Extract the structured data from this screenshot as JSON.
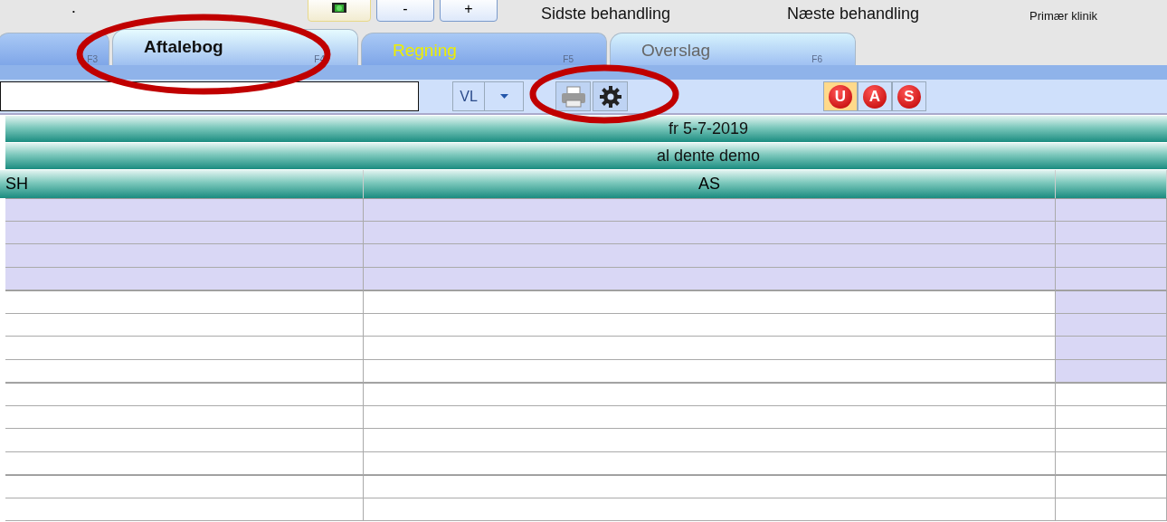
{
  "top_bar": {
    "dot": "•",
    "buttons": [
      {
        "kind": "icon"
      },
      {
        "kind": "text",
        "label": "-"
      },
      {
        "kind": "text",
        "label": "+"
      }
    ],
    "labels": [
      "Sidste behandling",
      "Næste behandling",
      "Primær klinik"
    ]
  },
  "tabs": [
    {
      "key": "F3",
      "selected": false
    },
    {
      "label": "Aftalebog",
      "key": "F4",
      "selected": true,
      "color": "#111111"
    },
    {
      "label": "Regning",
      "key": "F5",
      "selected": false,
      "color": "#eeee00"
    },
    {
      "label": "Overslag",
      "key": "F6",
      "selected": false,
      "color": "#666666"
    }
  ],
  "toolbar": {
    "select": {
      "value": "VL"
    },
    "status_buttons": [
      {
        "label": "U",
        "selected": true
      },
      {
        "label": "A",
        "selected": false
      },
      {
        "label": "S",
        "selected": false
      }
    ]
  },
  "schedule": {
    "date": "fr 5-7-2019",
    "clinic": "al dente demo",
    "columns": [
      {
        "kind": "label",
        "label": "SH"
      },
      {
        "kind": "label",
        "label": "AS"
      },
      {
        "kind": "blank"
      }
    ],
    "rows": [
      {
        "shaded": [
          true,
          true,
          true
        ]
      },
      {
        "shaded": [
          true,
          true,
          true
        ]
      },
      {
        "shaded": [
          true,
          true,
          true
        ]
      },
      {
        "shaded": [
          true,
          true,
          true
        ]
      },
      {
        "shaded": [
          false,
          false,
          true
        ]
      },
      {
        "shaded": [
          false,
          false,
          true
        ]
      },
      {
        "shaded": [
          false,
          false,
          true
        ]
      },
      {
        "shaded": [
          false,
          false,
          true
        ]
      },
      {
        "shaded": [
          false,
          false,
          false
        ]
      },
      {
        "shaded": [
          false,
          false,
          false
        ]
      },
      {
        "shaded": [
          false,
          false,
          false
        ]
      },
      {
        "shaded": [
          false,
          false,
          false
        ]
      },
      {
        "shaded": [
          false,
          false,
          false
        ]
      },
      {
        "shaded": [
          false,
          false,
          false
        ]
      }
    ]
  },
  "annotations": [
    {
      "kind": "ellipse"
    },
    {
      "kind": "ellipse"
    }
  ]
}
